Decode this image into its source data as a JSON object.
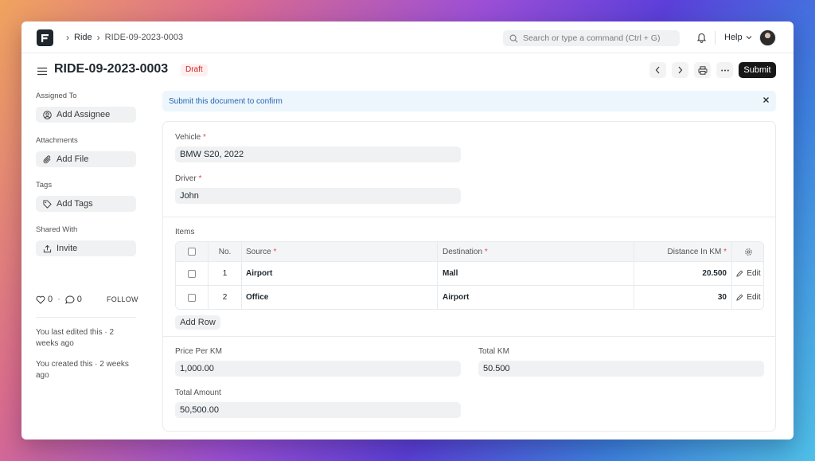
{
  "navbar": {
    "logo_letter": "F",
    "breadcrumbs": [
      "Ride",
      "RIDE-09-2023-0003"
    ],
    "search_placeholder": "Search or type a command (Ctrl + G)",
    "help_label": "Help"
  },
  "page": {
    "title": "RIDE-09-2023-0003",
    "status": "Draft",
    "submit_label": "Submit"
  },
  "sidebar": {
    "assigned_to_label": "Assigned To",
    "add_assignee_label": "Add Assignee",
    "attachments_label": "Attachments",
    "add_file_label": "Add File",
    "tags_label": "Tags",
    "add_tags_label": "Add Tags",
    "shared_with_label": "Shared With",
    "invite_label": "Invite",
    "like_count": "0",
    "comment_count": "0",
    "follow_label": "FOLLOW",
    "last_edited": "You last edited this · 2 weeks ago",
    "created": "You created this · 2 weeks ago"
  },
  "alert": {
    "message": "Submit this document to confirm"
  },
  "form": {
    "vehicle_label": "Vehicle",
    "vehicle_value": "BMW S20, 2022",
    "driver_label": "Driver",
    "driver_value": "John",
    "items_label": "Items",
    "columns": {
      "no": "No.",
      "source": "Source",
      "destination": "Destination",
      "distance": "Distance In KM"
    },
    "rows": [
      {
        "no": "1",
        "source": "Airport",
        "destination": "Mall",
        "distance": "20.500",
        "edit": "Edit"
      },
      {
        "no": "2",
        "source": "Office",
        "destination": "Airport",
        "distance": "30",
        "edit": "Edit"
      }
    ],
    "add_row_label": "Add Row",
    "price_per_km_label": "Price Per KM",
    "price_per_km_value": "1,000.00",
    "total_km_label": "Total KM",
    "total_km_value": "50.500",
    "total_amount_label": "Total Amount",
    "total_amount_value": "50,500.00"
  }
}
